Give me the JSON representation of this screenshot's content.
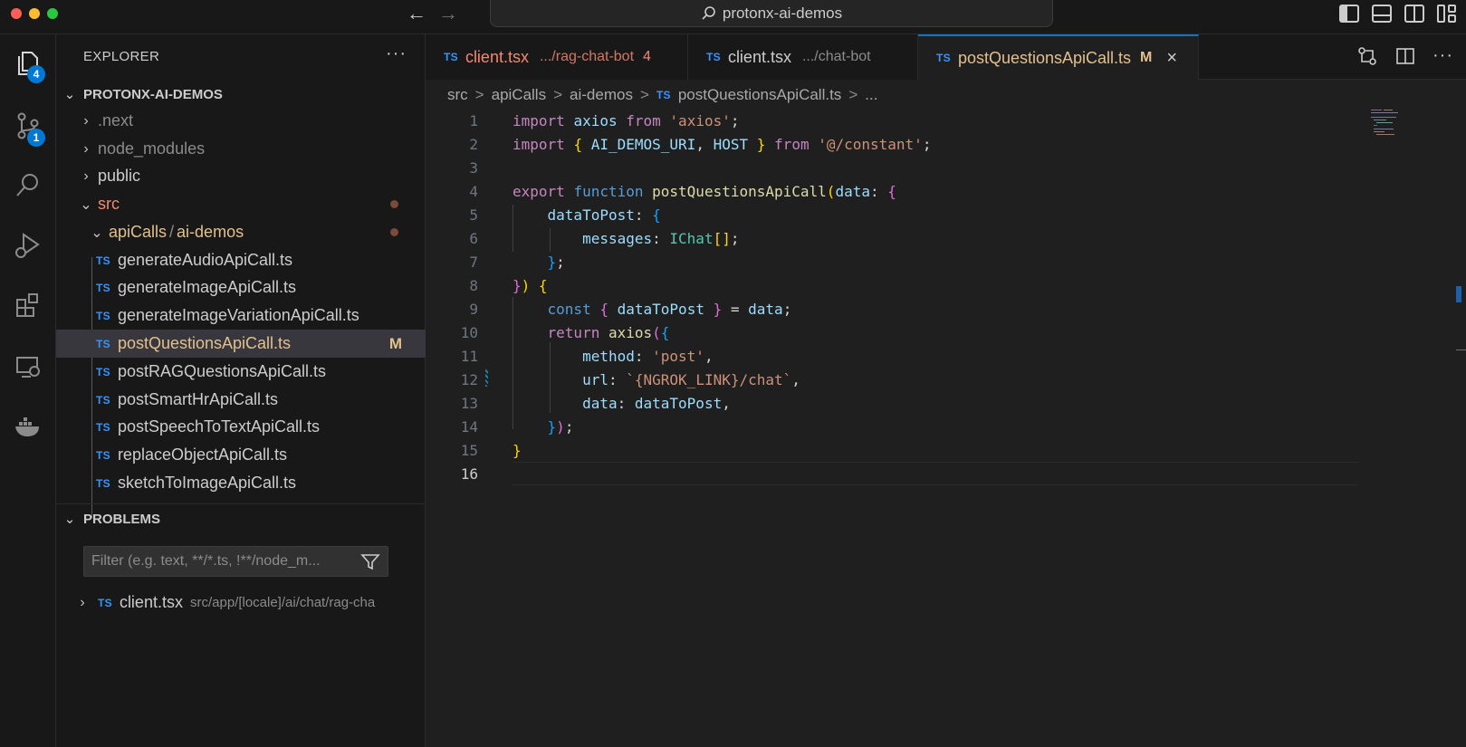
{
  "titlebar": {
    "traffic_colors": [
      "#ff5f57",
      "#febc2e",
      "#28c840"
    ],
    "search_text": "protonx-ai-demos"
  },
  "activity_bar": {
    "explorer_badge": "4",
    "scm_badge": "1"
  },
  "explorer": {
    "header": "EXPLORER",
    "more": "···",
    "root": "PROTONX-AI-DEMOS",
    "items": [
      {
        "label": ".next",
        "type": "folder"
      },
      {
        "label": "node_modules",
        "type": "folder"
      },
      {
        "label": "public",
        "type": "folder"
      },
      {
        "label": "src",
        "type": "folder-open"
      },
      {
        "label": "apiCalls",
        "label2": "ai-demos",
        "sep": "/",
        "type": "folder-open"
      },
      {
        "label": "generateAudioApiCall.ts",
        "icon": "TS"
      },
      {
        "label": "generateImageApiCall.ts",
        "icon": "TS"
      },
      {
        "label": "generateImageVariationApiCall.ts",
        "icon": "TS"
      },
      {
        "label": "postQuestionsApiCall.ts",
        "icon": "TS",
        "status": "M"
      },
      {
        "label": "postRAGQuestionsApiCall.ts",
        "icon": "TS"
      },
      {
        "label": "postSmartHrApiCall.ts",
        "icon": "TS"
      },
      {
        "label": "postSpeechToTextApiCall.ts",
        "icon": "TS"
      },
      {
        "label": "replaceObjectApiCall.ts",
        "icon": "TS"
      },
      {
        "label": "sketchToImageApiCall.ts",
        "icon": "TS"
      }
    ]
  },
  "problems": {
    "title": "PROBLEMS",
    "filter_placeholder": "Filter (e.g. text, **/*.ts, !**/node_m...",
    "item": {
      "icon": "TS",
      "label": "client.tsx",
      "path": "src/app/[locale]/ai/chat/rag-cha"
    }
  },
  "tabs": [
    {
      "icon": "TS",
      "label": "client.tsx",
      "path": ".../rag-chat-bot",
      "count": "4",
      "color": "#f48771"
    },
    {
      "icon": "TS",
      "label": "client.tsx",
      "path": ".../chat-bot",
      "color": "#cccccc"
    },
    {
      "icon": "TS",
      "label": "postQuestionsApiCall.ts",
      "status": "M",
      "color": "#e2c08d",
      "close": "×"
    }
  ],
  "breadcrumb": {
    "parts": [
      "src",
      "apiCalls",
      "ai-demos",
      "postQuestionsApiCall.ts",
      "..."
    ],
    "sep": ">",
    "file_icon": "TS"
  },
  "editor": {
    "line_numbers": [
      "1",
      "2",
      "3",
      "4",
      "5",
      "6",
      "7",
      "8",
      "9",
      "10",
      "11",
      "12",
      "13",
      "14",
      "15",
      "16"
    ]
  }
}
